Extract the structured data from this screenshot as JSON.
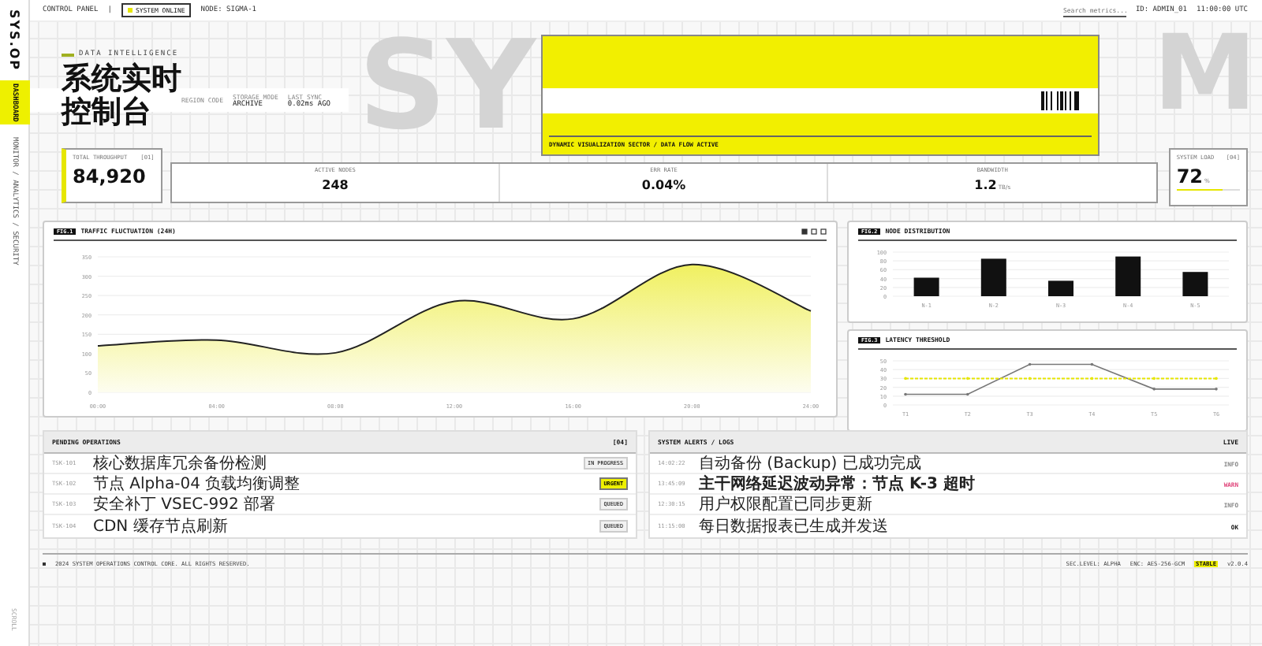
{
  "sidebar": {
    "logo": "SYS.OP",
    "nav_items": [
      {
        "label": "DASHBOARD",
        "selected": true
      },
      {
        "label": "MONITOR / ANALYTICS / SECURITY",
        "selected": false
      }
    ],
    "footer_label": "SCROLL"
  },
  "top_bar": {
    "section": "CONTROL PANEL",
    "separator": "|",
    "status_badge": "SYSTEM ONLINE",
    "node": "NODE: SIGMA-1",
    "search": {
      "placeholder": "Search metrics..."
    },
    "user_id": "ID: ADMIN_01",
    "time": "11:00:00 UTC"
  },
  "backdrop_texts": [
    "SY",
    "M"
  ],
  "header": {
    "eyebrow": "DATA INTELLIGENCE",
    "title_lines": [
      "系统实时",
      "控制台"
    ],
    "meta": [
      {
        "label": "REGION CODE"
      },
      {
        "label": "STORAGE MODE",
        "value": "ARCHIVE"
      },
      {
        "label": "LAST SYNC",
        "value": "0.02ms AGO"
      }
    ]
  },
  "banner": {
    "caption": "DYNAMIC VISUALIZATION SECTOR / DATA FLOW ACTIVE"
  },
  "stats": [
    {
      "label": "TOTAL THROUGHPUT",
      "index": "[01]",
      "value": "84,920"
    },
    {
      "label": "ACTIVE NODES",
      "value": "248"
    },
    {
      "label": "ERR RATE",
      "value": "0.04%"
    },
    {
      "label": "BANDWIDTH",
      "value": "1.2",
      "unit": "TB/s"
    }
  ],
  "system_load": {
    "label": "SYSTEM LOAD",
    "index": "[04]",
    "value": "72",
    "unit": "%",
    "level": 0.72
  },
  "traffic_chart": {
    "tag": "FIG.1",
    "title": "TRAFFIC FLUCTUATION (24H)",
    "chart_data": {
      "type": "area",
      "categories": [
        "00:00",
        "04:00",
        "08:00",
        "12:00",
        "16:00",
        "20:00",
        "24:00"
      ],
      "series": [
        {
          "color": "#222222",
          "values": [
            120,
            135,
            102,
            235,
            190,
            330,
            210
          ]
        }
      ],
      "ylim": [
        0,
        350
      ],
      "yticks": [
        0,
        50,
        100,
        150,
        200,
        250,
        300,
        350
      ],
      "grid": true
    }
  },
  "node_chart": {
    "tag": "FIG.2",
    "title": "NODE DISTRIBUTION",
    "chart_data": {
      "type": "bar",
      "categories": [
        "N-1",
        "N-2",
        "N-3",
        "N-4",
        "N-5"
      ],
      "series": [
        {
          "color": "#111111",
          "values": [
            42,
            85,
            35,
            90,
            55
          ]
        }
      ],
      "ylim": [
        0,
        100
      ],
      "yticks": [
        0,
        20,
        40,
        60,
        80,
        100
      ],
      "grid": true
    }
  },
  "latency_chart": {
    "tag": "FIG.3",
    "title": "LATENCY THRESHOLD",
    "chart_data": {
      "type": "line",
      "categories": [
        "T1",
        "T2",
        "T3",
        "T4",
        "T5",
        "T6"
      ],
      "series": [
        {
          "color": "#777777",
          "values": [
            12,
            12,
            46,
            46,
            18,
            18
          ]
        },
        {
          "color": "#e6e600",
          "values": [
            30,
            30,
            30,
            30,
            30,
            30
          ],
          "line_style": "dashed"
        }
      ],
      "ylim": [
        0,
        50
      ],
      "yticks": [
        0,
        10,
        20,
        30,
        40,
        50
      ],
      "grid": true
    }
  },
  "pending": {
    "title": "PENDING OPERATIONS",
    "count": "[04]",
    "rows": [
      {
        "id": "TSK-101",
        "title": "核心数据库冗余备份检测",
        "status": "IN PROGRESS",
        "urgent": false
      },
      {
        "id": "TSK-102",
        "title": "节点 Alpha-04 负载均衡调整",
        "status": "URGENT",
        "urgent": true
      },
      {
        "id": "TSK-103",
        "title": "安全补丁 VSEC-992 部署",
        "status": "QUEUED",
        "urgent": false
      },
      {
        "id": "TSK-104",
        "title": "CDN 缓存节点刷新",
        "status": "QUEUED",
        "urgent": false
      }
    ]
  },
  "alerts": {
    "title": "SYSTEM ALERTS / LOGS",
    "live": "LIVE",
    "rows": [
      {
        "time": "14:02:22",
        "message": "自动备份 (Backup) 已成功完成",
        "level": "INFO",
        "color": "#888888",
        "emphasis": false
      },
      {
        "time": "13:45:09",
        "message": "主干网络延迟波动异常：节点 K-3 超时",
        "level": "WARN",
        "color": "#e0457b",
        "emphasis": true
      },
      {
        "time": "12:30:15",
        "message": "用户权限配置已同步更新",
        "level": "INFO",
        "color": "#888888",
        "emphasis": false
      },
      {
        "time": "11:15:00",
        "message": "每日数据报表已生成并发送",
        "level": "OK",
        "color": "#111111",
        "emphasis": false
      }
    ]
  },
  "footer": {
    "copyright": "2024 SYSTEM OPERATIONS CONTROL CORE. ALL RIGHTS RESERVED.",
    "items": [
      "SEC.LEVEL: ALPHA",
      "ENC: AES-256-GCM"
    ],
    "state": "STABLE",
    "version": "v2.0.4"
  }
}
